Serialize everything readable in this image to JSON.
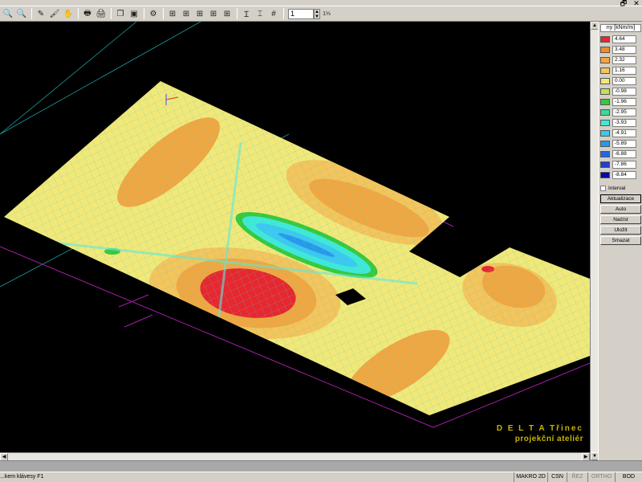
{
  "window": {
    "controls": [
      "_",
      "🗗",
      "✕"
    ]
  },
  "toolbar": {
    "groups": [
      [
        "zoom-in-icon",
        "zoom-out-icon"
      ],
      [
        "pencil-icon",
        "brush-icon",
        "hand-icon"
      ],
      [
        "print-icon",
        "printer-setup-icon"
      ],
      [
        "copy-icon",
        "select-icon"
      ],
      [
        "settings-icon"
      ],
      [
        "node-icon-1",
        "node-icon-2",
        "node-icon-3",
        "node-icon-4",
        "node-icon-5"
      ],
      [
        "beam-icon",
        "column-icon",
        "grid-icon"
      ]
    ],
    "page_value": "1",
    "page_icon_label": "1⅓"
  },
  "legend": {
    "title": "ny [kNm/m]",
    "items": [
      {
        "color": "#e8262e",
        "value": "4.64"
      },
      {
        "color": "#f08a2c",
        "value": "3.48"
      },
      {
        "color": "#f2a640",
        "value": "2.32"
      },
      {
        "color": "#f5c45a",
        "value": "1.16"
      },
      {
        "color": "#f2e878",
        "value": "0.00"
      },
      {
        "color": "#c8e050",
        "value": "-0.98"
      },
      {
        "color": "#38c83a",
        "value": "-1.96"
      },
      {
        "color": "#3cd898",
        "value": "-2.95"
      },
      {
        "color": "#40e8d8",
        "value": "-3.93"
      },
      {
        "color": "#3cc8f0",
        "value": "-4.91"
      },
      {
        "color": "#2898e8",
        "value": "-5.89"
      },
      {
        "color": "#2068e0",
        "value": "-6.88"
      },
      {
        "color": "#2040c8",
        "value": "-7.86"
      },
      {
        "color": "#0808a8",
        "value": "-8.84"
      }
    ],
    "interval_label": "Interval",
    "buttons": [
      "Aktualizace",
      "Auto",
      "Načíst",
      "Uložit",
      "Smazat"
    ]
  },
  "brand": {
    "line1": "D E L T A  Třinec",
    "line2": "projekční ateliér"
  },
  "status": {
    "hint": "...kem klávesy F1",
    "cells": [
      "MAKRO 2D",
      "CSN",
      "ŘEZ",
      "ORTHO",
      "BOD"
    ]
  }
}
